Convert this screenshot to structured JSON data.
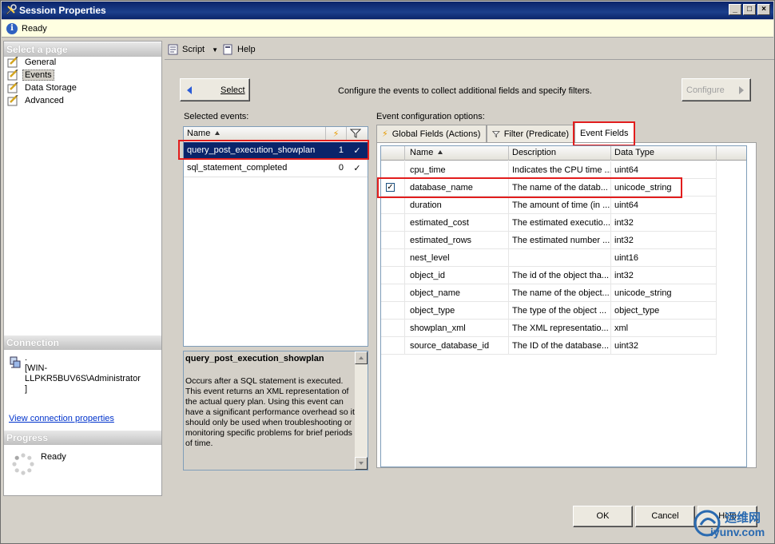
{
  "window": {
    "title": "Session Properties",
    "controls": [
      "_",
      "□",
      "×"
    ]
  },
  "status": {
    "text": "Ready"
  },
  "left": {
    "select_page_header": "Select a page",
    "pages": [
      {
        "label": "General",
        "icon": "page-icon"
      },
      {
        "label": "Events",
        "icon": "page-icon",
        "selected": true
      },
      {
        "label": "Data Storage",
        "icon": "page-icon"
      },
      {
        "label": "Advanced",
        "icon": "page-icon"
      }
    ],
    "connection_header": "Connection",
    "connection_text": "[WIN-LLPKR5BUV6S\\Administrator ]",
    "connection_text_line0": ".",
    "connection_text_line1": "[WIN-LLPKR5BUV6S\\Administrator",
    "connection_text_line2": "]",
    "view_connection_link": "View connection properties",
    "progress_header": "Progress",
    "progress_text": "Ready"
  },
  "toolbar": {
    "script_label": "Script",
    "help_label": "Help"
  },
  "main": {
    "select_button": "Select",
    "instruction": "Configure the events to collect additional fields and specify filters.",
    "configure_button": "Configure",
    "selected_events_label": "Selected events:",
    "events_grid": {
      "col_name": "Name",
      "rows": [
        {
          "name": "query_post_execution_showplan",
          "count": "1",
          "filter": "✓",
          "selected": true
        },
        {
          "name": "sql_statement_completed",
          "count": "0",
          "filter": "✓",
          "selected": false
        }
      ]
    },
    "description_title": "query_post_execution_showplan",
    "description_text": "Occurs after a SQL statement is executed. This event returns an XML representation of the actual query plan. Using this event can have a significant performance overhead so it should only be used when troubleshooting or monitoring specific problems for brief periods of time.",
    "config_options_label": "Event configuration options:",
    "tabs": [
      {
        "label": "Global Fields (Actions)",
        "icon": "lightning-icon"
      },
      {
        "label": "Filter (Predicate)",
        "icon": "filter-icon"
      },
      {
        "label": "Event Fields",
        "active": true
      }
    ],
    "fields_grid": {
      "columns": [
        "Name",
        "Description",
        "Data Type"
      ],
      "rows": [
        {
          "checked": false,
          "name": "cpu_time",
          "description": "Indicates the CPU time ...",
          "type": "uint64"
        },
        {
          "checked": true,
          "name": "database_name",
          "description": "The name of the datab...",
          "type": "unicode_string"
        },
        {
          "checked": false,
          "name": "duration",
          "description": "The amount of time (in ...",
          "type": "uint64"
        },
        {
          "checked": false,
          "name": "estimated_cost",
          "description": "The estimated executio...",
          "type": "int32"
        },
        {
          "checked": false,
          "name": "estimated_rows",
          "description": "The estimated number ...",
          "type": "int32"
        },
        {
          "checked": false,
          "name": "nest_level",
          "description": "",
          "type": "uint16"
        },
        {
          "checked": false,
          "name": "object_id",
          "description": "The id of the object tha...",
          "type": "int32"
        },
        {
          "checked": false,
          "name": "object_name",
          "description": "The name of the object...",
          "type": "unicode_string"
        },
        {
          "checked": false,
          "name": "object_type",
          "description": "The type of the object ...",
          "type": "object_type"
        },
        {
          "checked": false,
          "name": "showplan_xml",
          "description": "The XML representatio...",
          "type": "xml"
        },
        {
          "checked": false,
          "name": "source_database_id",
          "description": "The ID of the database...",
          "type": "uint32"
        }
      ]
    }
  },
  "footer": {
    "ok": "OK",
    "cancel": "Cancel",
    "help": "Help"
  },
  "watermark": {
    "cn": "运维网",
    "url": "iyunv.com"
  },
  "colors": {
    "title_bar": "#0a246a",
    "selection": "#0a246a",
    "highlight_box": "#e21d1d",
    "link": "#0033cc"
  }
}
